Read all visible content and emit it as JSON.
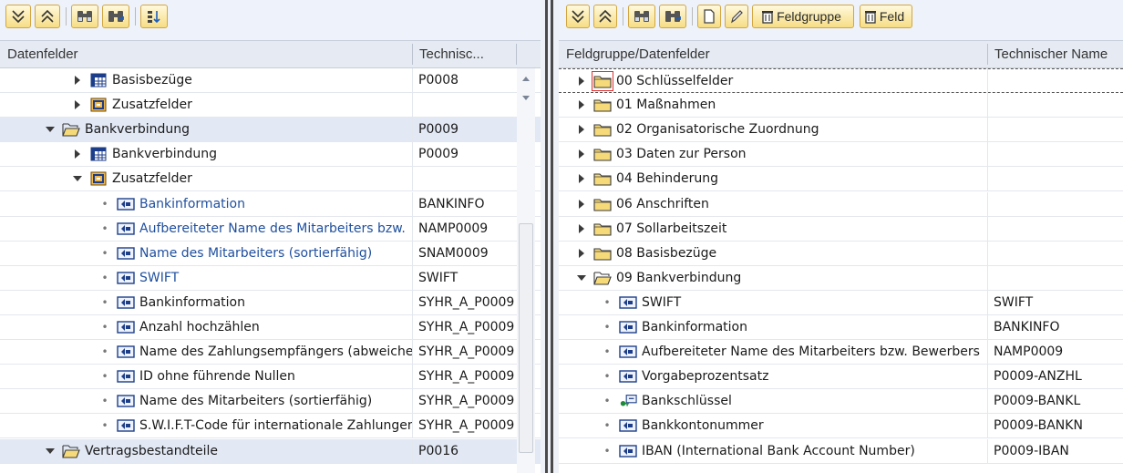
{
  "left": {
    "header": {
      "col1": "Datenfelder",
      "col2": "Technisc..."
    },
    "rows": [
      {
        "label": "Basisbezüge",
        "tech": "P0008",
        "icon": "table",
        "state": "collapsed",
        "level": 2,
        "blue": false,
        "sel": false
      },
      {
        "label": "Zusatzfelder",
        "tech": "",
        "icon": "addfield",
        "state": "collapsed",
        "level": 2,
        "blue": false,
        "sel": false
      },
      {
        "label": "Bankverbindung",
        "tech": "P0009",
        "icon": "folder-open",
        "state": "expanded",
        "level": 1,
        "blue": false,
        "sel": true
      },
      {
        "label": "Bankverbindung",
        "tech": "P0009",
        "icon": "table",
        "state": "collapsed",
        "level": 2,
        "blue": false,
        "sel": false
      },
      {
        "label": "Zusatzfelder",
        "tech": "",
        "icon": "addfield",
        "state": "expanded",
        "level": 2,
        "blue": false,
        "sel": false
      },
      {
        "label": "Bankinformation",
        "tech": "BANKINFO",
        "icon": "field",
        "state": "leaf",
        "level": 3,
        "blue": true,
        "sel": false
      },
      {
        "label": "Aufbereiteter Name des Mitarbeiters bzw.",
        "tech": "NAMP0009",
        "icon": "field",
        "state": "leaf",
        "level": 3,
        "blue": true,
        "sel": false
      },
      {
        "label": "Name des Mitarbeiters (sortierfähig)",
        "tech": "SNAM0009",
        "icon": "field",
        "state": "leaf",
        "level": 3,
        "blue": true,
        "sel": false
      },
      {
        "label": "SWIFT",
        "tech": "SWIFT",
        "icon": "field",
        "state": "leaf",
        "level": 3,
        "blue": true,
        "sel": false
      },
      {
        "label": "Bankinformation",
        "tech": "SYHR_A_P0009",
        "icon": "field",
        "state": "leaf",
        "level": 3,
        "blue": false,
        "sel": false
      },
      {
        "label": "Anzahl hochzählen",
        "tech": "SYHR_A_P0009",
        "icon": "field",
        "state": "leaf",
        "level": 3,
        "blue": false,
        "sel": false
      },
      {
        "label": "Name des Zahlungsempfängers (abweichend)",
        "tech": "SYHR_A_P0009",
        "icon": "field",
        "state": "leaf",
        "level": 3,
        "blue": false,
        "sel": false
      },
      {
        "label": "ID ohne führende Nullen",
        "tech": "SYHR_A_P0009",
        "icon": "field",
        "state": "leaf",
        "level": 3,
        "blue": false,
        "sel": false
      },
      {
        "label": "Name des Mitarbeiters (sortierfähig)",
        "tech": "SYHR_A_P0009",
        "icon": "field",
        "state": "leaf",
        "level": 3,
        "blue": false,
        "sel": false
      },
      {
        "label": "S.W.I.F.T-Code für internationale Zahlungen",
        "tech": "SYHR_A_P0009",
        "icon": "field",
        "state": "leaf",
        "level": 3,
        "blue": false,
        "sel": false
      },
      {
        "label": "Vertragsbestandteile",
        "tech": "P0016",
        "icon": "folder-open",
        "state": "expanded",
        "level": 1,
        "blue": false,
        "sel": true
      }
    ]
  },
  "right": {
    "toolbar": {
      "feldgruppe_label": "Feldgruppe",
      "feld_label": "Feld"
    },
    "header": {
      "col1": "Feldgruppe/Datenfelder",
      "col2": "Technischer Name"
    },
    "rows": [
      {
        "label": "00 Schlüsselfelder",
        "tech": "",
        "icon": "folder",
        "state": "collapsed",
        "level": 1,
        "focus": true
      },
      {
        "label": "01 Maßnahmen",
        "tech": "",
        "icon": "folder",
        "state": "collapsed",
        "level": 1
      },
      {
        "label": "02 Organisatorische Zuordnung",
        "tech": "",
        "icon": "folder",
        "state": "collapsed",
        "level": 1
      },
      {
        "label": "03 Daten zur Person",
        "tech": "",
        "icon": "folder",
        "state": "collapsed",
        "level": 1
      },
      {
        "label": "04 Behinderung",
        "tech": "",
        "icon": "folder",
        "state": "collapsed",
        "level": 1
      },
      {
        "label": "06 Anschriften",
        "tech": "",
        "icon": "folder",
        "state": "collapsed",
        "level": 1
      },
      {
        "label": "07 Sollarbeitszeit",
        "tech": "",
        "icon": "folder",
        "state": "collapsed",
        "level": 1
      },
      {
        "label": "08 Basisbezüge",
        "tech": "",
        "icon": "folder",
        "state": "collapsed",
        "level": 1
      },
      {
        "label": "09 Bankverbindung",
        "tech": "",
        "icon": "folder-open",
        "state": "expanded",
        "level": 1
      },
      {
        "label": "SWIFT",
        "tech": "SWIFT",
        "icon": "field",
        "state": "leaf",
        "level": 2
      },
      {
        "label": "Bankinformation",
        "tech": "BANKINFO",
        "icon": "field",
        "state": "leaf",
        "level": 2
      },
      {
        "label": "Aufbereiteter Name des Mitarbeiters bzw. Bewerbers",
        "tech": "NAMP0009",
        "icon": "field",
        "state": "leaf",
        "level": 2
      },
      {
        "label": "Vorgabeprozentsatz",
        "tech": "P0009-ANZHL",
        "icon": "field",
        "state": "leaf",
        "level": 2
      },
      {
        "label": "Bankschlüssel",
        "tech": "P0009-BANKL",
        "icon": "keyfield",
        "state": "leaf",
        "level": 2
      },
      {
        "label": "Bankkontonummer",
        "tech": "P0009-BANKN",
        "icon": "field",
        "state": "leaf",
        "level": 2
      },
      {
        "label": "IBAN (International Bank Account Number)",
        "tech": "P0009-IBAN",
        "icon": "field",
        "state": "leaf",
        "level": 2
      }
    ]
  }
}
